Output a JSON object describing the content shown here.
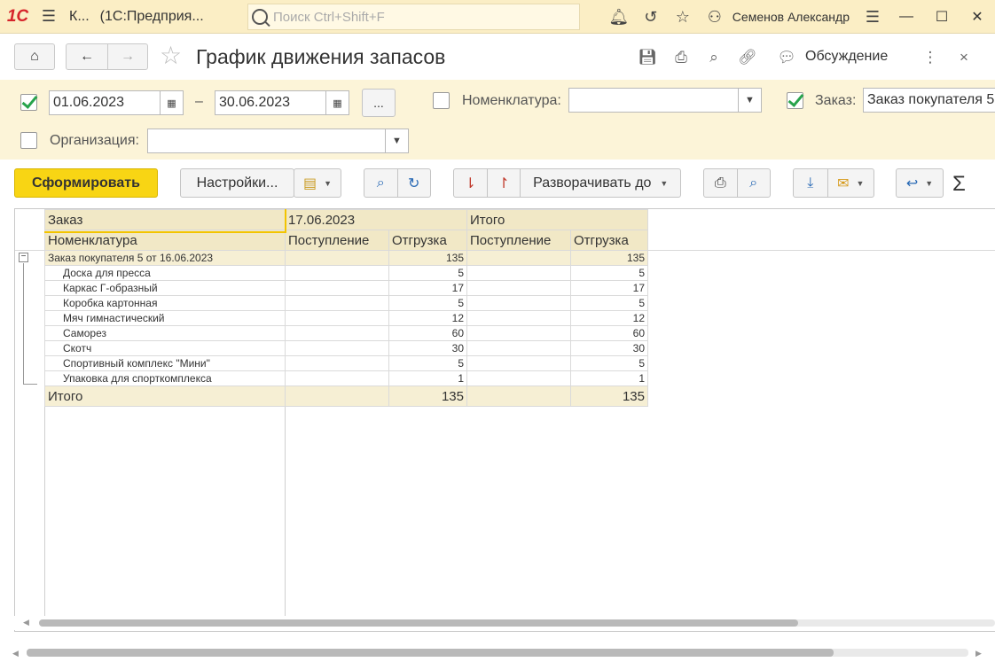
{
  "app": {
    "logo": "1С",
    "title_short": "К...",
    "title": "(1С:Предприя...",
    "search_placeholder": "Поиск Ctrl+Shift+F",
    "user": "Семенов Александр"
  },
  "header": {
    "title": "График движения запасов",
    "discuss_label": "Обсуждение"
  },
  "filters": {
    "period_enabled": true,
    "date_from": "01.06.2023",
    "dash": "–",
    "date_to": "30.06.2023",
    "dots_label": "...",
    "nomenclature_label": "Номенклатура:",
    "nomenclature_value": "",
    "order_label": "Заказ:",
    "order_value": "Заказ покупателя 5",
    "organization_label": "Организация:",
    "organization_value": ""
  },
  "commands": {
    "generate": "Сформировать",
    "settings": "Настройки...",
    "expand_to": "Разворачивать до"
  },
  "report": {
    "header_row1": {
      "col1": "Заказ",
      "date": "17.06.2023",
      "total": "Итого"
    },
    "header_row2": {
      "col1": "Номенклатура",
      "receipt": "Поступление",
      "shipment": "Отгрузка",
      "receipt_total": "Поступление",
      "shipment_total": "Отгрузка"
    },
    "group": {
      "name": "Заказ покупателя 5 от 16.06.2023",
      "receipt": "",
      "shipment": "135",
      "receipt_total": "",
      "shipment_total": "135"
    },
    "items": [
      {
        "name": "Доска для пресса",
        "shipment": "5",
        "shipment_total": "5"
      },
      {
        "name": "Каркас Г-образный",
        "shipment": "17",
        "shipment_total": "17"
      },
      {
        "name": "Коробка картонная",
        "shipment": "5",
        "shipment_total": "5"
      },
      {
        "name": "Мяч гимнастический",
        "shipment": "12",
        "shipment_total": "12"
      },
      {
        "name": "Саморез",
        "shipment": "60",
        "shipment_total": "60"
      },
      {
        "name": "Скотч",
        "shipment": "30",
        "shipment_total": "30"
      },
      {
        "name": "Спортивный комплекс \"Мини\"",
        "shipment": "5",
        "shipment_total": "5"
      },
      {
        "name": "Упаковка для спорткомплекса",
        "shipment": "1",
        "shipment_total": "1"
      }
    ],
    "total": {
      "label": "Итого",
      "shipment": "135",
      "shipment_total": "135"
    }
  },
  "colors": {
    "accent": "#f8d514",
    "titlebar_bg": "#fbeec5",
    "filter_bg": "#fcf4d8",
    "check_green": "#27a34b"
  }
}
